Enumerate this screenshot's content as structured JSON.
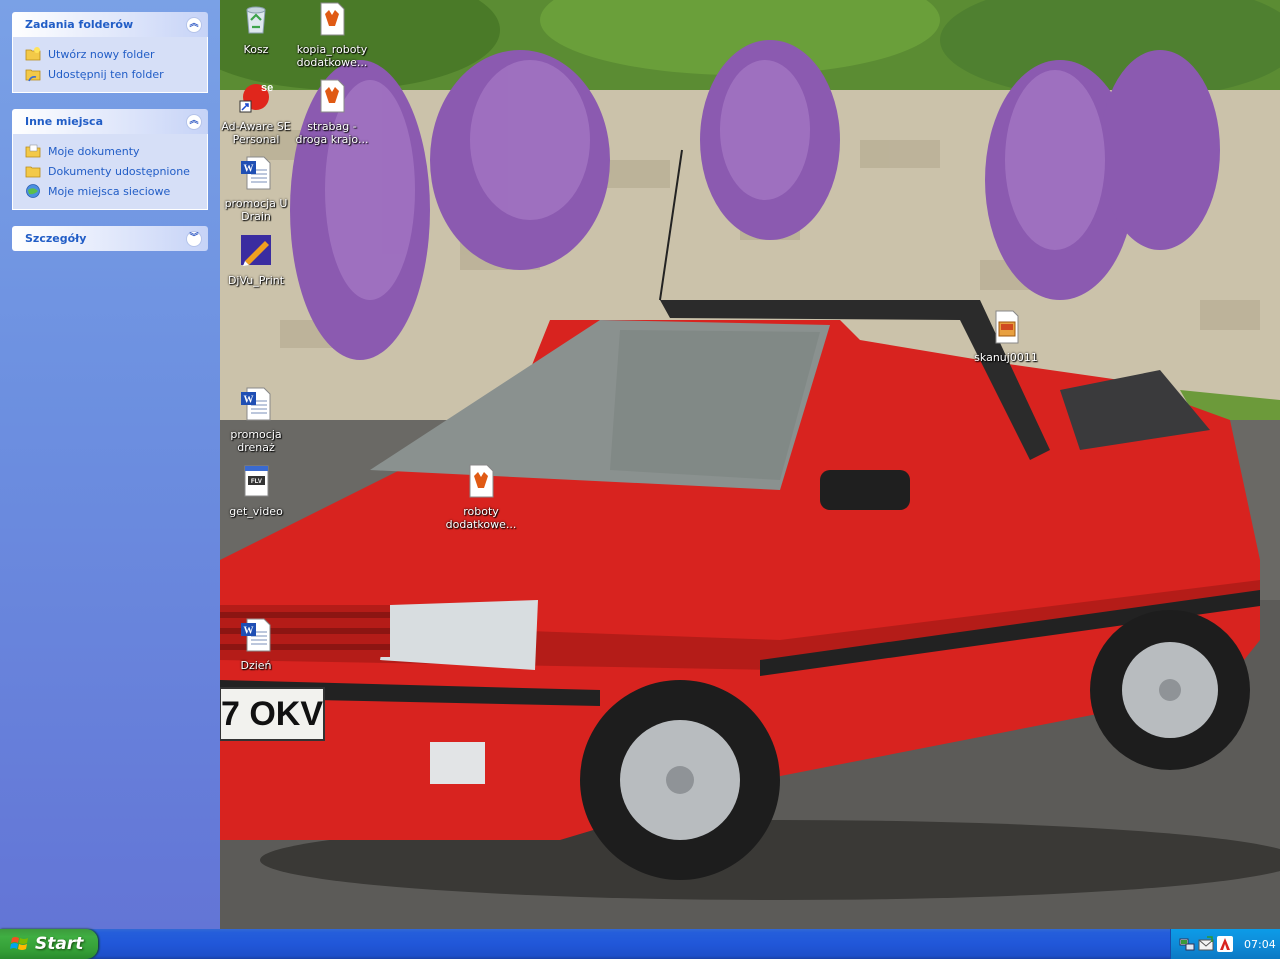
{
  "taskpane": {
    "panels": [
      {
        "title": "Zadania folderów",
        "chevron": "collapse",
        "items": [
          {
            "label": "Utwórz nowy folder",
            "icon": "new-folder-icon"
          },
          {
            "label": "Udostępnij ten folder",
            "icon": "share-folder-icon"
          }
        ]
      },
      {
        "title": "Inne miejsca",
        "chevron": "collapse",
        "items": [
          {
            "label": "Moje dokumenty",
            "icon": "folder-icon"
          },
          {
            "label": "Dokumenty udostępnione",
            "icon": "folder-icon"
          },
          {
            "label": "Moje miejsca sieciowe",
            "icon": "network-icon"
          }
        ]
      },
      {
        "title": "Szczegóły",
        "chevron": "expand",
        "items": []
      }
    ]
  },
  "desktop": {
    "icons": [
      {
        "label": "Kosz",
        "icon": "recycle-bin-icon"
      },
      {
        "label": "kopia_roboty dodatkowe...",
        "icon": "fox-document-icon"
      },
      {
        "label": "Ad-Aware SE Personal",
        "icon": "adaware-shortcut-icon"
      },
      {
        "label": "strabag - droga krajo...",
        "icon": "fox-document-icon"
      },
      {
        "label": "promocja U Drain",
        "icon": "word-document-icon"
      },
      {
        "label": "DjVu_Print",
        "icon": "djvu-print-icon"
      },
      {
        "label": "skanuj0011",
        "icon": "image-file-icon"
      },
      {
        "label": "promocja drenaż",
        "icon": "word-document-icon"
      },
      {
        "label": "get_video",
        "icon": "flv-file-icon"
      },
      {
        "label": "roboty dodatkowe...",
        "icon": "fox-document-icon"
      },
      {
        "label": "Dzień",
        "icon": "word-document-icon"
      }
    ]
  },
  "wallpaper": {
    "plate_text": "7 OKV"
  },
  "taskbar": {
    "start_label": "Start",
    "clock": "07:04",
    "tray_icons": [
      "network-tray-icon",
      "mail-tray-icon",
      "antivirus-tray-icon"
    ]
  },
  "colors": {
    "taskbar_blue": "#245edb",
    "start_green": "#3fae42",
    "pane_blue": "#6c8fe0",
    "link_blue": "#215dc6",
    "car_red": "#d8231f"
  }
}
